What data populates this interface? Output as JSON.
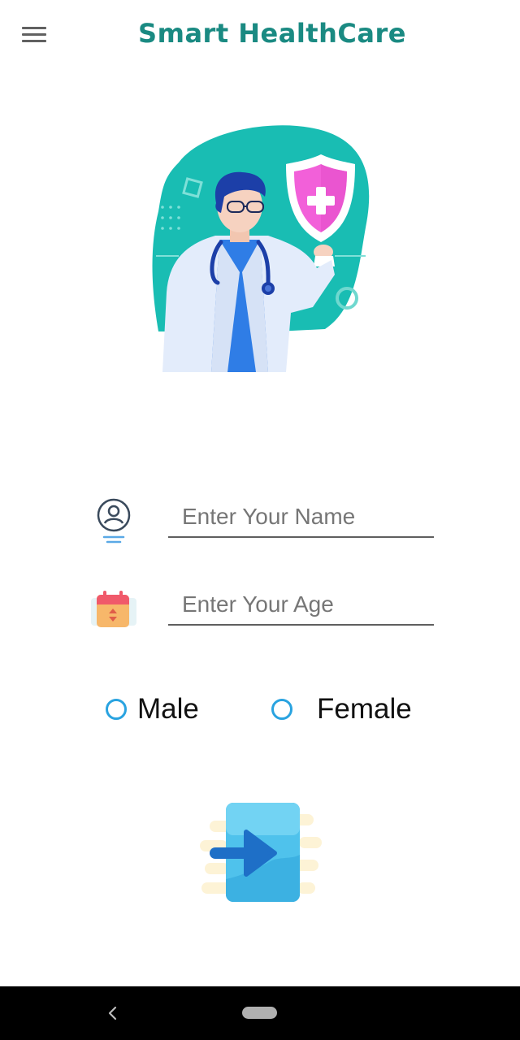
{
  "app_bar": {
    "title": "Smart HealthCare",
    "title_color": "#1a8a82",
    "menu_icon": "hamburger-menu-icon"
  },
  "hero": {
    "icon": "doctor-with-shield-illustration"
  },
  "form": {
    "name_field": {
      "icon": "user-profile-icon",
      "placeholder": "Enter Your Name",
      "value": ""
    },
    "age_field": {
      "icon": "calendar-icon",
      "placeholder": "Enter Your Age",
      "value": ""
    }
  },
  "gender": {
    "options": [
      {
        "label": "Male",
        "selected": false
      },
      {
        "label": "Female",
        "selected": false
      }
    ],
    "accent": "#29a3e0"
  },
  "submit": {
    "icon": "login-arrow-icon"
  },
  "system_nav": {
    "back_icon": "back-chevron-icon",
    "home_icon": "home-pill-icon"
  }
}
